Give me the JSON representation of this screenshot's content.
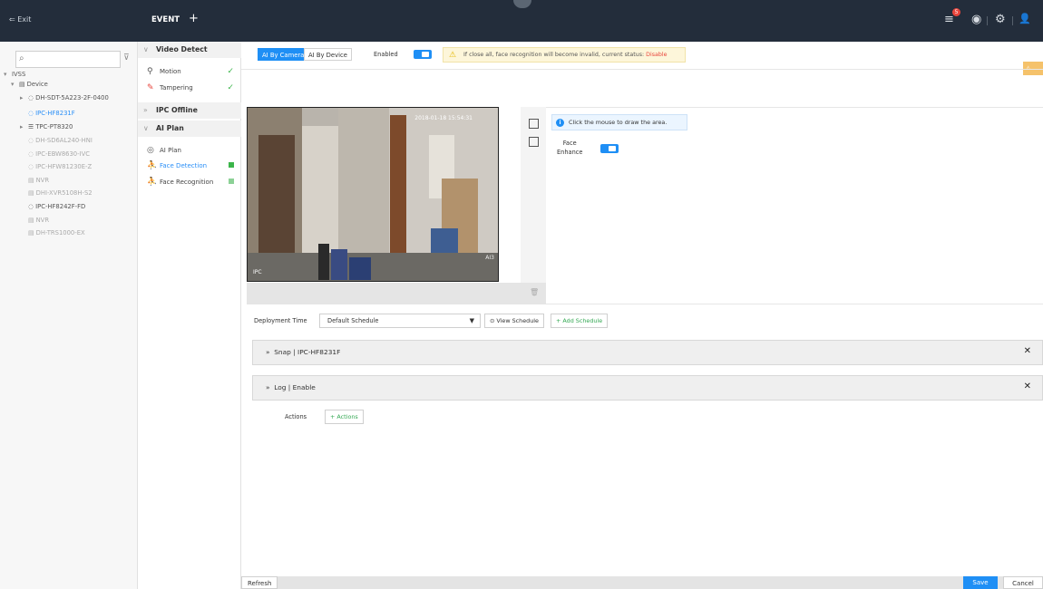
{
  "topbar": {
    "exit_label": "Exit",
    "tab_label": "EVENT",
    "add_tab": "+",
    "alarm_count": "5"
  },
  "tree": {
    "search_placeholder": "",
    "nodes": [
      {
        "label": "IVSS"
      },
      {
        "label": "Device"
      },
      {
        "label": "DH-SDT-5A223-2F-0400"
      },
      {
        "label": "IPC-HF8231F"
      },
      {
        "label": "TPC-PT8320"
      },
      {
        "label": "DH-SD6AL240-HNI"
      },
      {
        "label": "IPC-EBW8630-IVC"
      },
      {
        "label": "IPC-HFW81230E-Z"
      },
      {
        "label": "NVR"
      },
      {
        "label": "DHI-XVR5108H-S2"
      },
      {
        "label": "IPC-HF8242F-FD"
      },
      {
        "label": "NVR"
      },
      {
        "label": "DH-TRS1000-EX"
      }
    ]
  },
  "events": {
    "video_detect": "Video Detect",
    "motion": "Motion",
    "tampering": "Tampering",
    "ipc_offline": "IPC Offline",
    "ai_plan_group": "AI Plan",
    "ai_plan": "AI Plan",
    "face_detection": "Face Detection",
    "face_recognition": "Face Recognition"
  },
  "main": {
    "ai_by_camera": "AI By Camera",
    "ai_by_device": "AI By Device",
    "enabled": "Enabled",
    "warning_text": "If close all, face recognition will become invalid, current status:",
    "warning_status": "Disable",
    "info_text": "Click the mouse to draw the area.",
    "face_label": "Face",
    "enhance_label": "Enhance",
    "video_timestamp": "2018-01-18 15:54:31",
    "video_channel": "IPC",
    "video_watermark": "AI3",
    "deployment_label": "Deployment Time",
    "schedule_value": "Default Schedule",
    "view_schedule": "View Schedule",
    "add_schedule": "Add Schedule",
    "snap_row": "Snap | IPC-HF8231F",
    "log_row": "Log | Enable",
    "actions_label": "Actions",
    "actions_button": "Actions"
  },
  "bottom": {
    "refresh": "Refresh",
    "save": "Save",
    "cancel": "Cancel"
  },
  "colors": {
    "topbar": "#232d3b",
    "accent": "#1f8ff5",
    "success": "#3bb54a",
    "warning": "#e4b600",
    "danger": "#e8453c"
  }
}
